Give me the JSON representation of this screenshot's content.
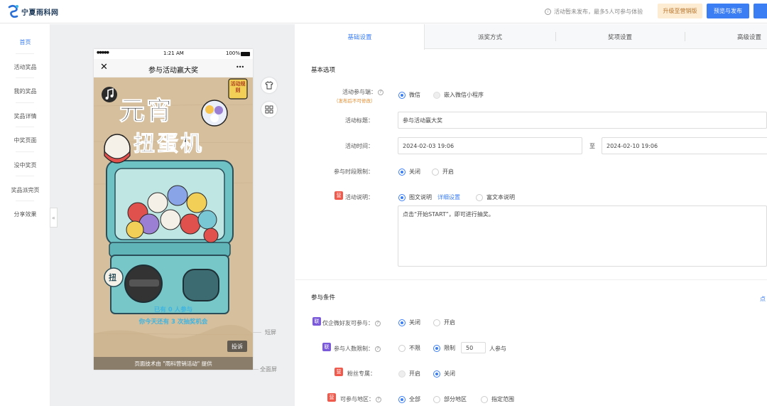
{
  "header": {
    "brand": "宁夏雨科网",
    "notice": "活动暂未发布，最多5人可参与体验",
    "upgrade_label": "升级至营销版",
    "preview_publish_label": "预览与发布",
    "extra_label": "保"
  },
  "sidebar": {
    "items": [
      {
        "label": "首页",
        "active": true
      },
      {
        "label": "活动奖品"
      },
      {
        "label": "我的奖品"
      },
      {
        "label": "奖品详情"
      },
      {
        "label": "中奖页面"
      },
      {
        "label": "没中奖页"
      },
      {
        "label": "奖品派完页"
      },
      {
        "label": "分享效果"
      }
    ],
    "collapse_icon": "«"
  },
  "phone": {
    "status_signal": "●●●●●",
    "status_time": "1:21 AM",
    "status_battery": "100%",
    "close_icon": "✕",
    "title": "参与活动赢大奖",
    "more_icon": "•••",
    "poster": {
      "title_line1": "元宵",
      "title_line2": "扭蛋机",
      "tag": "活动规则",
      "twist_label": "扭",
      "participants_line": "已有 0 人参与",
      "chances_line": "你今天还有 3 次抽奖机会",
      "report_label": "投诉"
    },
    "footer": "页面技术由 \"雨科营销活动\" 提供"
  },
  "preview_labels": {
    "short_screen": "短屏",
    "full_screen": "全面屏"
  },
  "tabs": [
    {
      "label": "基础设置",
      "active": true
    },
    {
      "label": "派奖方式"
    },
    {
      "label": "奖项设置"
    },
    {
      "label": "高级设置"
    }
  ],
  "basic": {
    "section_title": "基本选项",
    "platform_label": "活动参与端：",
    "platform_sub": "（发布后不可修改）",
    "platform_options": [
      "微信",
      "嵌入微信小程序"
    ],
    "title_label": "活动标题：",
    "title_value": "参与活动赢大奖",
    "time_label": "活动时间：",
    "time_start": "2024-02-03 19:06",
    "time_sep": "至",
    "time_end": "2024-02-10 19:06",
    "period_label": "参与时段限制：",
    "period_options": [
      "关闭",
      "开启"
    ],
    "desc_badge": "营",
    "desc_label": "活动说明：",
    "desc_options": [
      "图文说明",
      "富文本说明"
    ],
    "desc_detail_link": "详细设置",
    "desc_text": "点击“开始START”，即可进行抽奖。"
  },
  "conditions": {
    "section_title": "参与条件",
    "right_link": "点",
    "wecom_badge": "联",
    "wecom_label": "仅企微好友可参与：",
    "wecom_options": [
      "关闭",
      "开启"
    ],
    "count_badge": "联",
    "count_label": "参与人数限制：",
    "count_options": [
      "不限",
      "限制"
    ],
    "count_value": "50",
    "count_unit": "人参与",
    "fans_badge": "营",
    "fans_label": "粉丝专属：",
    "fans_options": [
      "开启",
      "关闭"
    ],
    "region_badge": "营",
    "region_label": "可参与地区：",
    "region_options": [
      "全部",
      "部分地区",
      "指定范围"
    ]
  },
  "colors": {
    "accent": "#3b7ef4",
    "warning": "#e38a2a",
    "badge_red": "#ef5a4d",
    "badge_purple": "#7a5ad8"
  }
}
